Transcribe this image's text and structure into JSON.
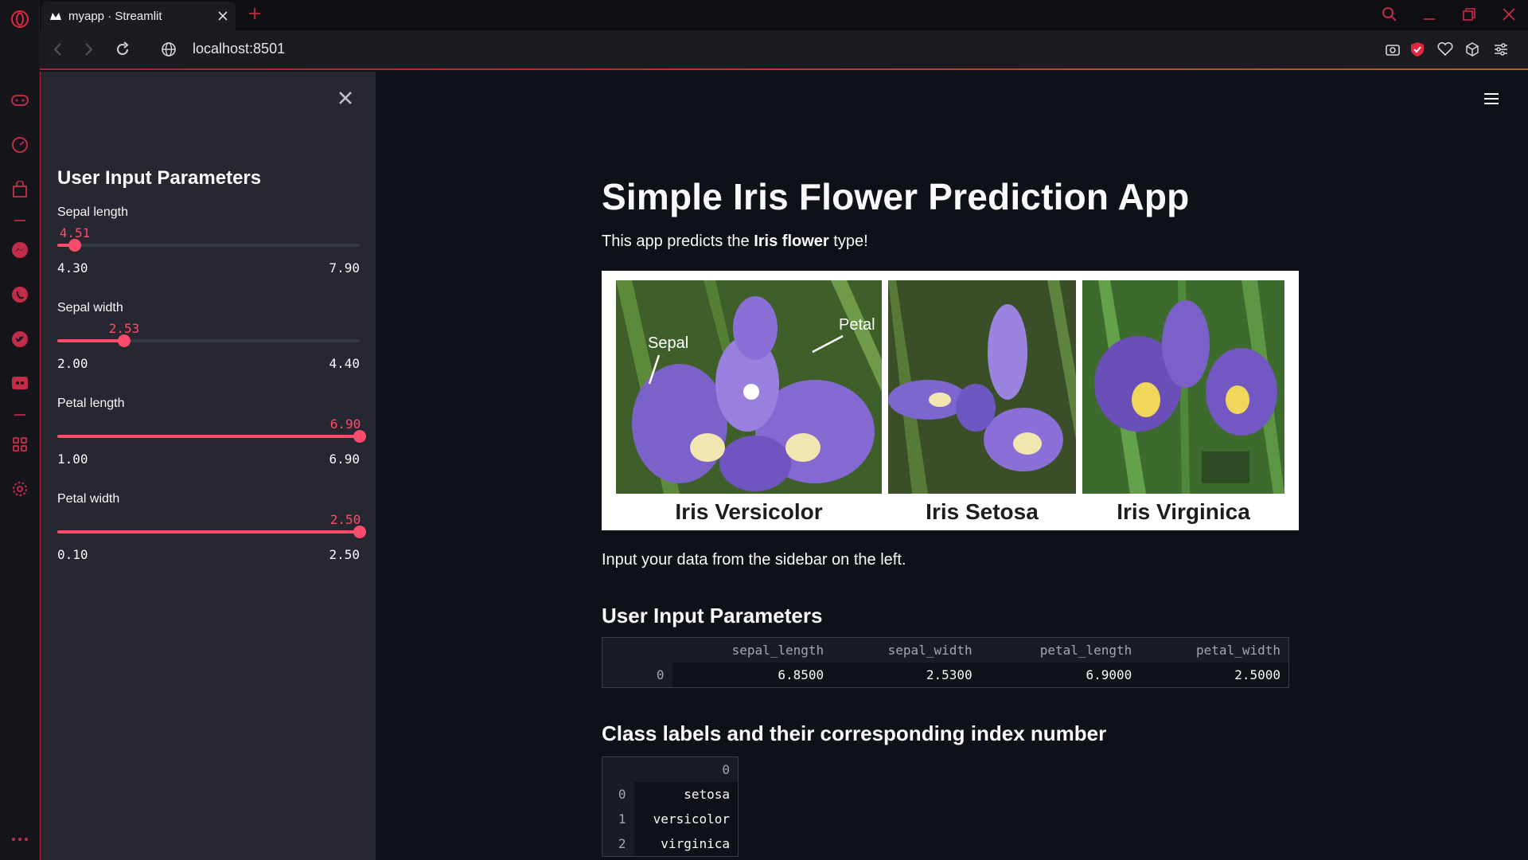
{
  "browser": {
    "tab_title": "myapp · Streamlit",
    "url": "localhost:8501",
    "accent": "#ff4b6b"
  },
  "sidebar": {
    "heading": "User Input Parameters",
    "sliders": [
      {
        "label": "Sepal length",
        "value": "4.51",
        "min": "4.30",
        "max": "7.90",
        "fraction": 0.058
      },
      {
        "label": "Sepal width",
        "value": "2.53",
        "min": "2.00",
        "max": "4.40",
        "fraction": 0.221
      },
      {
        "label": "Petal length",
        "value": "6.90",
        "min": "1.00",
        "max": "6.90",
        "fraction": 1.0
      },
      {
        "label": "Petal width",
        "value": "2.50",
        "min": "0.10",
        "max": "2.50",
        "fraction": 1.0
      }
    ]
  },
  "main": {
    "title": "Simple Iris Flower Prediction App",
    "intro_pre": "This app predicts the ",
    "intro_bold": "Iris flower",
    "intro_post": " type!",
    "image": {
      "labels": {
        "sepal": "Sepal",
        "petal": "Petal"
      },
      "captions": [
        "Iris Versicolor",
        "Iris Setosa",
        "Iris Virginica"
      ]
    },
    "instruction": "Input your data from the sidebar on the left.",
    "params_heading": "User Input Parameters",
    "params_table": {
      "columns": [
        "sepal_length",
        "sepal_width",
        "petal_length",
        "petal_width"
      ],
      "rows": [
        {
          "index": "0",
          "cells": [
            "6.8500",
            "2.5300",
            "6.9000",
            "2.5000"
          ]
        }
      ]
    },
    "classes_heading": "Class labels and their corresponding index number",
    "classes_table": {
      "column": "0",
      "rows": [
        {
          "index": "0",
          "value": "setosa"
        },
        {
          "index": "1",
          "value": "versicolor"
        },
        {
          "index": "2",
          "value": "virginica"
        }
      ]
    }
  }
}
